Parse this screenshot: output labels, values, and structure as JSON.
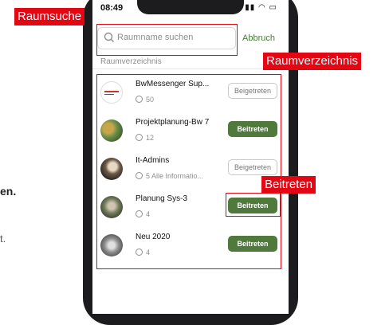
{
  "background": {
    "fragment_1": "en.",
    "fragment_2": "t."
  },
  "status": {
    "time": "08:49"
  },
  "search": {
    "placeholder": "Raumname suchen",
    "cancel": "Abbruch"
  },
  "section_title": "Raumverzeichnis",
  "rooms": [
    {
      "name": "BwMessenger Sup...",
      "meta": "50",
      "button": "Beigetreten",
      "state": "joined"
    },
    {
      "name": "Projektplanung-Bw 7",
      "meta": "12",
      "button": "Beitreten",
      "state": "join"
    },
    {
      "name": "It-Admins",
      "meta": "5  Alle Informatio...",
      "button": "Beigetreten",
      "state": "joined"
    },
    {
      "name": "Planung Sys-3",
      "meta": "4",
      "button": "Beitreten",
      "state": "join"
    },
    {
      "name": "Neu 2020",
      "meta": "4",
      "button": "Beitreten",
      "state": "join"
    }
  ],
  "annotations": {
    "search_label": "Raumsuche",
    "directory_label": "Raumverzeichnis",
    "join_label": "Beitreten"
  },
  "colors": {
    "accent": "#4f7a3c",
    "annotation": "#e30613"
  }
}
